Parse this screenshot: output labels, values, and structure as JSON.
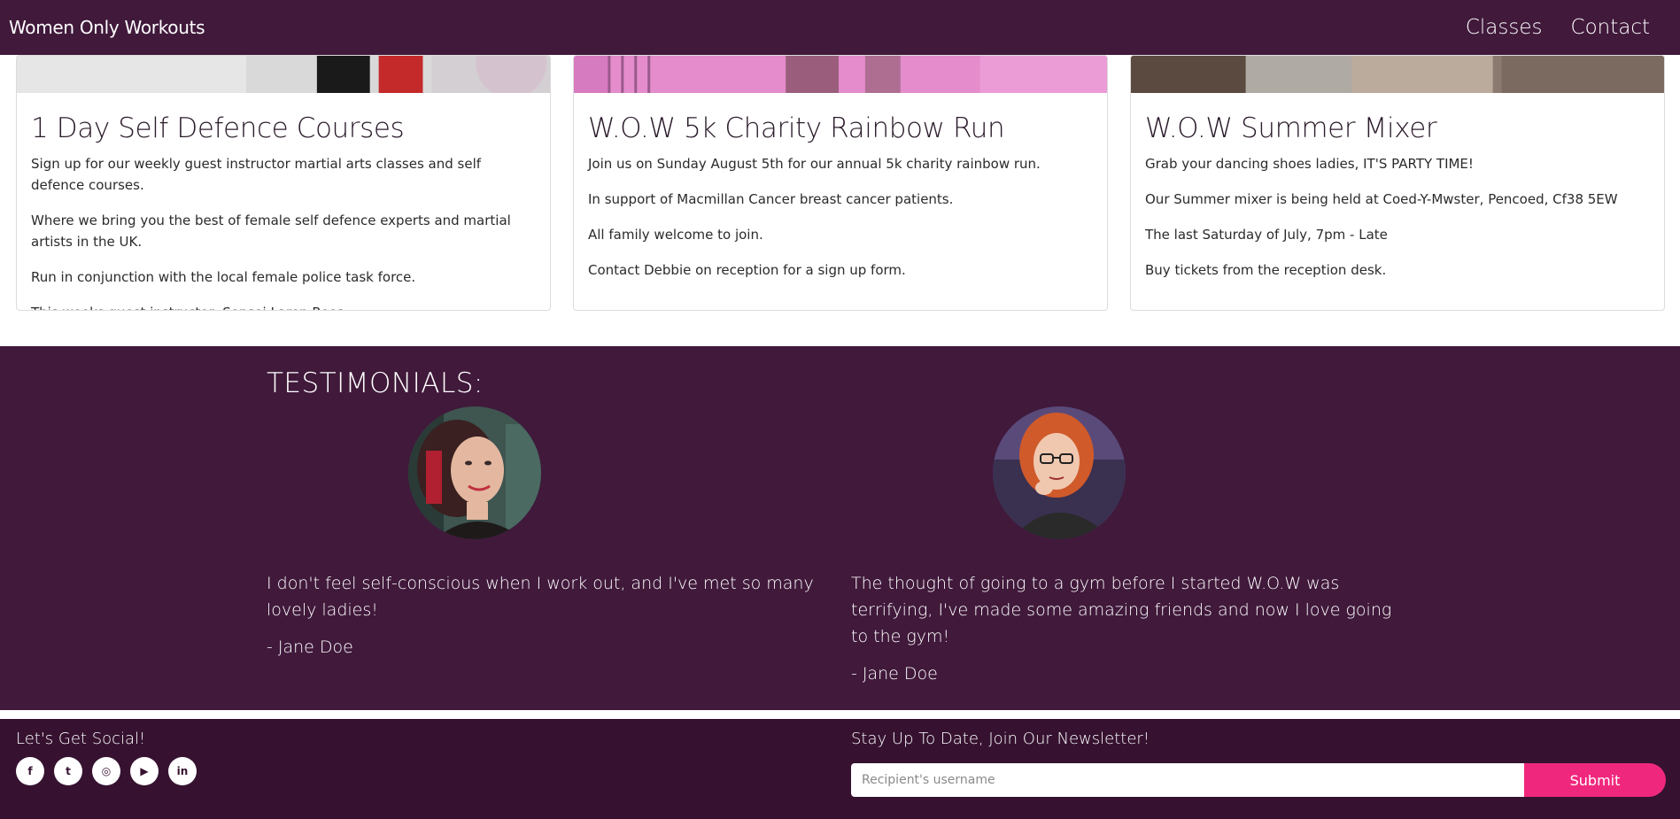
{
  "navbar": {
    "brand": "Women Only Workouts",
    "links": [
      "Classes",
      "Contact"
    ]
  },
  "cards": [
    {
      "title": "1 Day Self Defence Courses",
      "paragraphs": [
        "Sign up for our weekly guest instructor martial arts classes and self defence courses.",
        "Where we bring you the best of female self defence experts and martial artists in the UK.",
        "Run in conjunction with the local female police task force.",
        "This weeks guest instructor: Sensei Laren Rees"
      ]
    },
    {
      "title": "W.O.W 5k Charity Rainbow Run",
      "paragraphs": [
        "Join us on Sunday August 5th for our annual 5k charity rainbow run.",
        "In support of Macmillan Cancer breast cancer patients.",
        "All family welcome to join.",
        "Contact Debbie on reception for a sign up form."
      ]
    },
    {
      "title": "W.O.W Summer Mixer",
      "paragraphs": [
        "Grab your dancing shoes ladies, IT'S PARTY TIME!",
        "Our Summer mixer is being held at Coed-Y-Mwster, Pencoed, Cf38 5EW",
        "The last Saturday of July, 7pm - Late",
        "Buy tickets from the reception desk."
      ]
    }
  ],
  "testimonials": {
    "heading": "TESTIMONIALS:",
    "items": [
      {
        "quote": "I don't feel self-conscious when I work out, and I've met so many lovely ladies!",
        "author": "- Jane Doe"
      },
      {
        "quote": "The thought of going to a gym before I started W.O.W was terrifying, I've made some amazing friends and now I love going to the gym!",
        "author": "- Jane Doe"
      }
    ]
  },
  "footer": {
    "social_heading": "Let's Get Social!",
    "social_icons": [
      {
        "name": "facebook-icon",
        "glyph": "f"
      },
      {
        "name": "twitter-icon",
        "glyph": "t"
      },
      {
        "name": "instagram-icon",
        "glyph": "◎"
      },
      {
        "name": "youtube-icon",
        "glyph": "▶"
      },
      {
        "name": "linkedin-icon",
        "glyph": "in"
      }
    ],
    "newsletter_heading": "Stay Up To Date, Join Our Newsletter!",
    "newsletter_placeholder": "Recipient's username",
    "submit_label": "Submit"
  },
  "colors": {
    "primary_purple": "#40193b",
    "footer_purple": "#361230",
    "accent_pink": "#f0287d"
  }
}
